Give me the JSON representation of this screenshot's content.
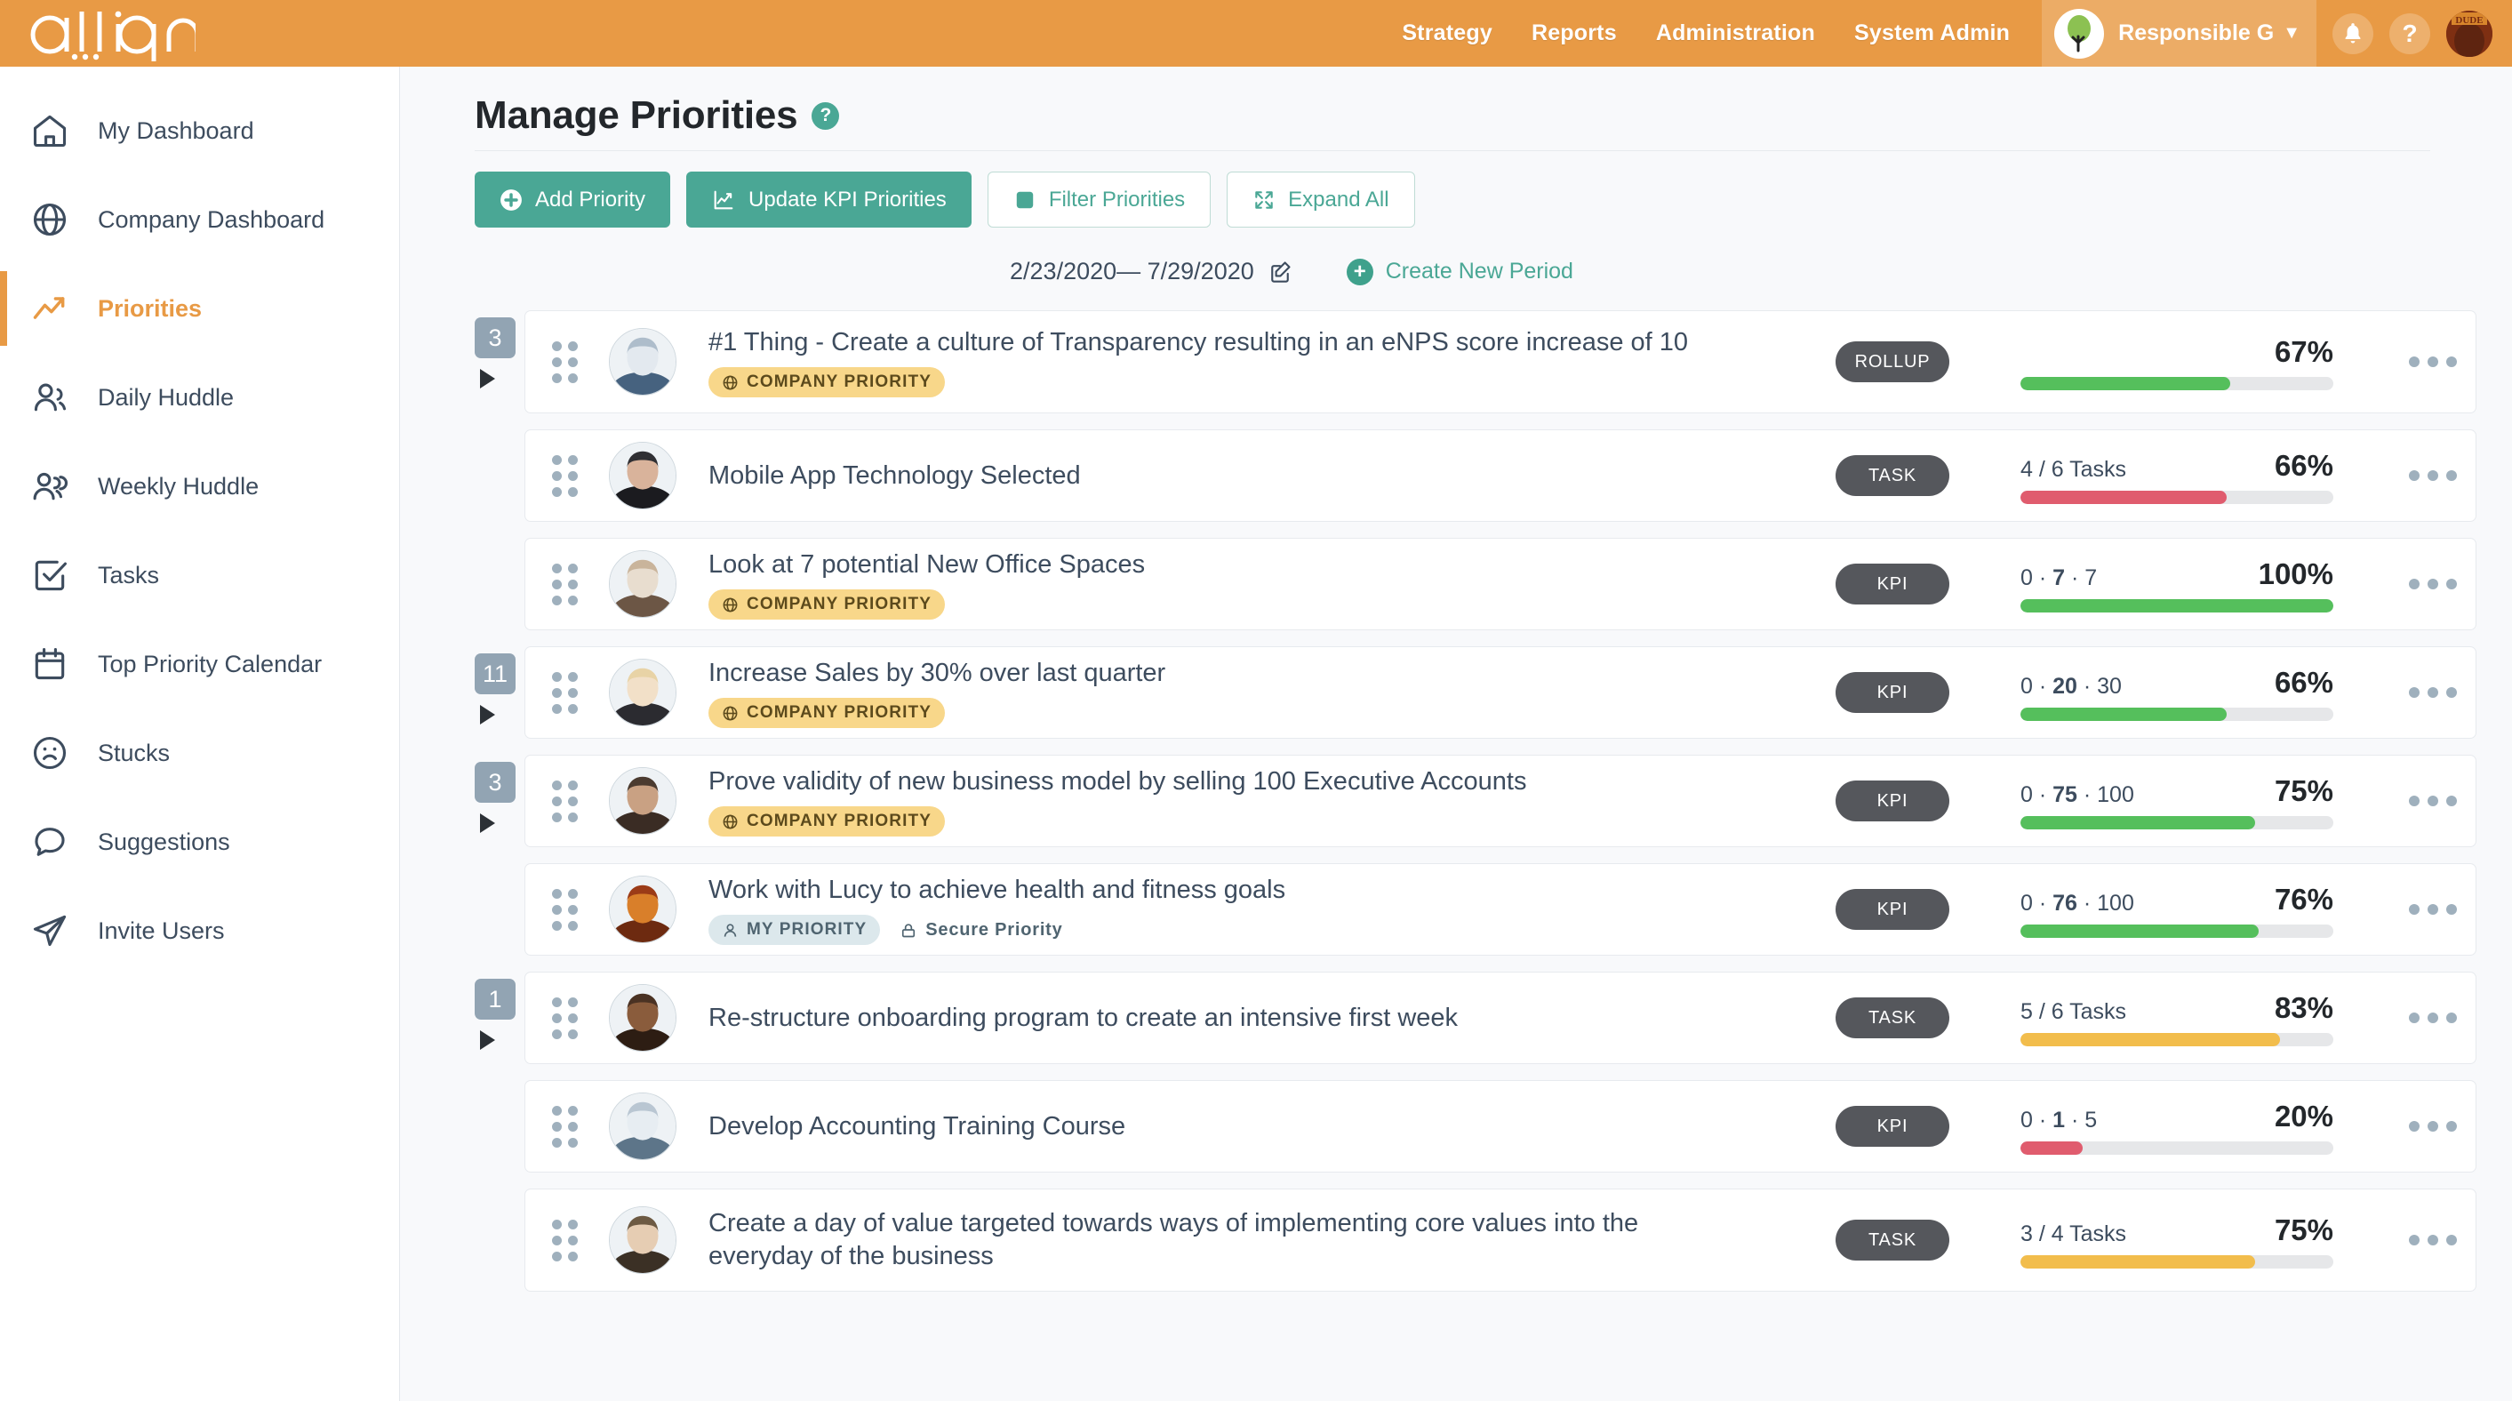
{
  "brand": {
    "logo_text": "align",
    "orange": "#e89a45",
    "teal": "#4aa795",
    "green": "#55bf5c",
    "red": "#e05c6e",
    "yellow": "#f2bd4c",
    "badge_gray": "#55575c"
  },
  "topnav": {
    "links": [
      "Strategy",
      "Reports",
      "Administration",
      "System Admin"
    ],
    "company": "Responsible G",
    "caret": "▼",
    "company_icon": "tree-icon",
    "bell_icon": "notification-bell-icon",
    "help_icon": "?",
    "avatar_icon": "user-avatar"
  },
  "sidebar": {
    "items": [
      {
        "label": "My Dashboard",
        "icon": "home-icon",
        "active": false
      },
      {
        "label": "Company Dashboard",
        "icon": "globe-icon",
        "active": false
      },
      {
        "label": "Priorities",
        "icon": "trending-up-icon",
        "active": true
      },
      {
        "label": "Daily Huddle",
        "icon": "people-icon",
        "active": false
      },
      {
        "label": "Weekly Huddle",
        "icon": "people-group-icon",
        "active": false
      },
      {
        "label": "Tasks",
        "icon": "checkbox-icon",
        "active": false
      },
      {
        "label": "Top Priority Calendar",
        "icon": "calendar-icon",
        "active": false
      },
      {
        "label": "Stucks",
        "icon": "sad-face-icon",
        "active": false
      },
      {
        "label": "Suggestions",
        "icon": "chat-bubble-icon",
        "active": false
      },
      {
        "label": "Invite Users",
        "icon": "paper-plane-icon",
        "active": false
      }
    ]
  },
  "page": {
    "title": "Manage Priorities",
    "help_glyph": "?"
  },
  "toolbar": {
    "add_priority": "Add Priority",
    "update_kpi": "Update KPI Priorities",
    "filter": "Filter Priorities",
    "expand_all": "Expand All"
  },
  "period": {
    "range": "2/23/2020— 7/29/2020",
    "edit_icon": "edit-pencil-icon",
    "create_label": "Create New Period",
    "create_icon": "plus-circle-icon"
  },
  "rows": [
    {
      "count": "3",
      "has_expand": true,
      "title": "#1 Thing - Create a culture of Transparency resulting in an eNPS score increase of 10",
      "tags": [
        {
          "type": "company",
          "label": "COMPANY PRIORITY",
          "icon": "globe-icon"
        }
      ],
      "type": "ROLLUP",
      "metric_label": "",
      "metric_parts": [],
      "percent": "67%",
      "bar_pct": 67,
      "bar_color": "#55bf5c",
      "avatar": "man-blue-shirt",
      "avatar_colors": [
        "#aebdcb",
        "#e3e9ef",
        "#46627f"
      ]
    },
    {
      "count": "",
      "has_expand": false,
      "title": "Mobile App Technology Selected",
      "tags": [],
      "type": "TASK",
      "metric_label": "4 / 6 Tasks",
      "metric_parts": [],
      "percent": "66%",
      "bar_pct": 66,
      "bar_color": "#e05c6e",
      "avatar": "woman-dark-hair",
      "avatar_colors": [
        "#2f2f33",
        "#d9b39b",
        "#1b1b1f"
      ]
    },
    {
      "count": "",
      "has_expand": false,
      "title": "Look at 7 potential New Office Spaces",
      "tags": [
        {
          "type": "company",
          "label": "COMPANY PRIORITY",
          "icon": "globe-icon"
        }
      ],
      "type": "KPI",
      "metric_label": "",
      "metric_parts": [
        "0",
        "7",
        "7"
      ],
      "percent": "100%",
      "bar_pct": 100,
      "bar_color": "#55bf5c",
      "avatar": "man-grey-hair",
      "avatar_colors": [
        "#c9b49b",
        "#e8ddcf",
        "#6c5645"
      ]
    },
    {
      "count": "11",
      "has_expand": true,
      "title": "Increase Sales by 30% over last quarter",
      "tags": [
        {
          "type": "company",
          "label": "COMPANY PRIORITY",
          "icon": "globe-icon"
        }
      ],
      "type": "KPI",
      "metric_label": "",
      "metric_parts": [
        "0",
        "20",
        "30"
      ],
      "percent": "66%",
      "bar_pct": 66,
      "bar_color": "#55bf5c",
      "avatar": "woman-blonde",
      "avatar_colors": [
        "#e8d3a6",
        "#f2e0c8",
        "#2b2b30"
      ]
    },
    {
      "count": "3",
      "has_expand": true,
      "title": "Prove validity of new business model by selling 100 Executive Accounts",
      "tags": [
        {
          "type": "company",
          "label": "COMPANY PRIORITY",
          "icon": "globe-icon"
        }
      ],
      "type": "KPI",
      "metric_label": "",
      "metric_parts": [
        "0",
        "75",
        "100"
      ],
      "percent": "75%",
      "bar_pct": 75,
      "bar_color": "#55bf5c",
      "avatar": "man-dark-beard",
      "avatar_colors": [
        "#4b3b30",
        "#c9a183",
        "#3a2c24"
      ]
    },
    {
      "count": "",
      "has_expand": false,
      "title": "Work with Lucy to achieve health and fitness goals",
      "tags": [
        {
          "type": "my",
          "label": "MY PRIORITY",
          "icon": "person-icon"
        },
        {
          "type": "plain",
          "label": "Secure Priority",
          "icon": "lock-icon"
        }
      ],
      "type": "KPI",
      "metric_label": "",
      "metric_parts": [
        "0",
        "76",
        "100"
      ],
      "percent": "76%",
      "bar_pct": 76,
      "bar_color": "#55bf5c",
      "avatar": "dude-logo",
      "avatar_colors": [
        "#9b3b17",
        "#d97f2a",
        "#6d2a10"
      ]
    },
    {
      "count": "1",
      "has_expand": true,
      "title": "Re-structure onboarding program to create an intensive first week",
      "tags": [],
      "type": "TASK",
      "metric_label": "5 / 6 Tasks",
      "metric_parts": [],
      "percent": "83%",
      "bar_pct": 83,
      "bar_color": "#f2bd4c",
      "avatar": "man-dark-skin",
      "avatar_colors": [
        "#4a3223",
        "#8a5c3c",
        "#2d1d13"
      ]
    },
    {
      "count": "",
      "has_expand": false,
      "title": "Develop Accounting Training Course",
      "tags": [],
      "type": "KPI",
      "metric_label": "",
      "metric_parts": [
        "0",
        "1",
        "5"
      ],
      "percent": "20%",
      "bar_pct": 20,
      "bar_color": "#e05c6e",
      "avatar": "man-light-shirt",
      "avatar_colors": [
        "#b9c6d2",
        "#e7edf2",
        "#5d7589"
      ]
    },
    {
      "count": "",
      "has_expand": false,
      "title": "Create a day of value targeted towards ways of implementing core values into the everyday of the business",
      "tags": [],
      "type": "TASK",
      "metric_label": "3 / 4 Tasks",
      "metric_parts": [],
      "percent": "75%",
      "bar_pct": 75,
      "bar_color": "#f2bd4c",
      "avatar": "woman-smiling",
      "avatar_colors": [
        "#6d5a43",
        "#e6cdb3",
        "#3b3025"
      ]
    }
  ]
}
